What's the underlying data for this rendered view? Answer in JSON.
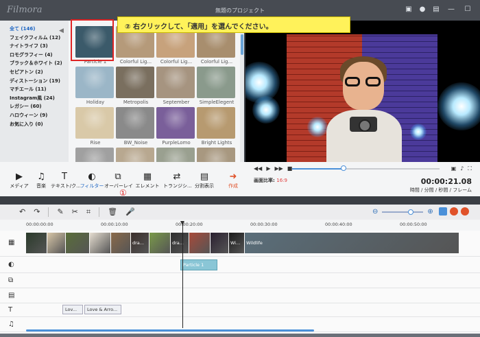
{
  "app": {
    "logo": "Filmora",
    "title": "無題のプロジェクト"
  },
  "window_icons": [
    "save-icon",
    "account-icon",
    "feedback-icon",
    "minimize-icon",
    "maximize-icon",
    "close-icon"
  ],
  "window_glyphs": {
    "save": "▣",
    "account": "●",
    "feedback": "▤",
    "minimize": "—",
    "maximize": "☐",
    "close": "✕"
  },
  "categories": [
    "全て (146)",
    "フェイクフィルム (12)",
    "ナイトライフ (3)",
    "ロモグラフィー (4)",
    "ブラック＆ホワイト (2)",
    "セピアトン (2)",
    "ディストーション (19)",
    "マチエール (11)",
    "Instagram風 (24)",
    "レガシー (60)",
    "ハロウィーン (9)",
    "お気に入り (0)"
  ],
  "filters": [
    {
      "name": "Particle 1",
      "color": "#3b5a6a"
    },
    {
      "name": "Colorful Lig...",
      "color": "#b59a7a"
    },
    {
      "name": "Colorful Lig...",
      "color": "#c7a27c"
    },
    {
      "name": "Colorful Lig...",
      "color": "#a88e6e"
    },
    {
      "name": "Holiday",
      "color": "#9bb6c7"
    },
    {
      "name": "Metropolis",
      "color": "#7a6f5f"
    },
    {
      "name": "September",
      "color": "#a69480"
    },
    {
      "name": "SimpleElegent",
      "color": "#8a9a8c"
    },
    {
      "name": "Rise",
      "color": "#d9c9a8"
    },
    {
      "name": "BW_Noise",
      "color": "#8a8a8a"
    },
    {
      "name": "PurpleLomo",
      "color": "#7a5f9a"
    },
    {
      "name": "Bright Lights",
      "color": "#b79a70"
    },
    {
      "name": "",
      "color": "#a0a0a0"
    },
    {
      "name": "",
      "color": "#b8a890"
    },
    {
      "name": "",
      "color": "#9aa090"
    },
    {
      "name": "",
      "color": "#a89880"
    }
  ],
  "callout": {
    "text": "② 右クリックして、「適用」を選んでください。"
  },
  "toolbar": [
    {
      "label": "メディア",
      "icon": "media-icon",
      "glyph": "▶"
    },
    {
      "label": "音楽",
      "icon": "music-icon",
      "glyph": "♫"
    },
    {
      "label": "テキスト/ク...",
      "icon": "text-icon",
      "glyph": "T"
    },
    {
      "label": "フィルター",
      "icon": "filter-icon",
      "glyph": "◐"
    },
    {
      "label": "オーバーレイ",
      "icon": "overlay-icon",
      "glyph": "⧉"
    },
    {
      "label": "エレメント",
      "icon": "element-icon",
      "glyph": "▦"
    },
    {
      "label": "トランジシ...",
      "icon": "transition-icon",
      "glyph": "⇄"
    },
    {
      "label": "分割表示",
      "icon": "split-screen-icon",
      "glyph": "▤"
    },
    {
      "label": "作成",
      "icon": "export-icon",
      "glyph": "➜"
    }
  ],
  "annotation_step1": "①",
  "player": {
    "ratio_label": "画面比率:",
    "ratio_value": "16:9",
    "timecode": "00:00:21.08",
    "time_units": "時間 / 分間 / 秒間 / フレーム",
    "progress": 0.35,
    "ctl_left": [
      "◀◀",
      "▶",
      "▶▶",
      "■"
    ],
    "ctl_right": [
      "▣",
      "♪",
      "⛶"
    ]
  },
  "edit_icons": [
    "undo-icon",
    "redo-icon",
    "pen-icon",
    "cut-icon",
    "crop-icon",
    "delete-icon",
    "mic-icon"
  ],
  "edit_glyphs": [
    "↶",
    "↷",
    "✎",
    "✂",
    "⌗",
    "🗑",
    "🎤"
  ],
  "zoom": {
    "minus": "⊖",
    "plus": "⊕",
    "level": 0.7
  },
  "ruler_ticks": [
    "00:00:00:00",
    "00:00:10:00",
    "00:00:20:00",
    "00:00:30:00",
    "00:00:40:00",
    "00:00:50:00"
  ],
  "tracks": [
    "video",
    "filter",
    "overlay",
    "element",
    "text",
    "music"
  ],
  "track_glyphs": {
    "video": "▦",
    "filter": "◐",
    "overlay": "⧉",
    "element": "▤",
    "text": "T",
    "music": "♫"
  },
  "video_clips": [
    {
      "label": "",
      "color": "#2a3a2a"
    },
    {
      "label": "",
      "color": "#d8c6a8"
    },
    {
      "label": "",
      "color": "#5a6e3a"
    },
    {
      "label": "",
      "color": "#e5ddd0"
    },
    {
      "label": "",
      "color": "#8a6a4a"
    },
    {
      "label": "dra...",
      "color": "#3a2e2a"
    },
    {
      "label": "",
      "color": "#7a9a4a"
    },
    {
      "label": "dra...",
      "color": "#2e2e2e"
    },
    {
      "label": "",
      "color": "#a84a3a"
    },
    {
      "label": "",
      "color": "#2a2030"
    },
    {
      "label": "Wi...",
      "color": "#1a1a1a"
    },
    {
      "label": "Wildlife",
      "color": "#5a6e7a"
    }
  ],
  "filter_clip": "Particle 1",
  "text_clips": [
    "Lov...",
    "Love & Arro..."
  ]
}
